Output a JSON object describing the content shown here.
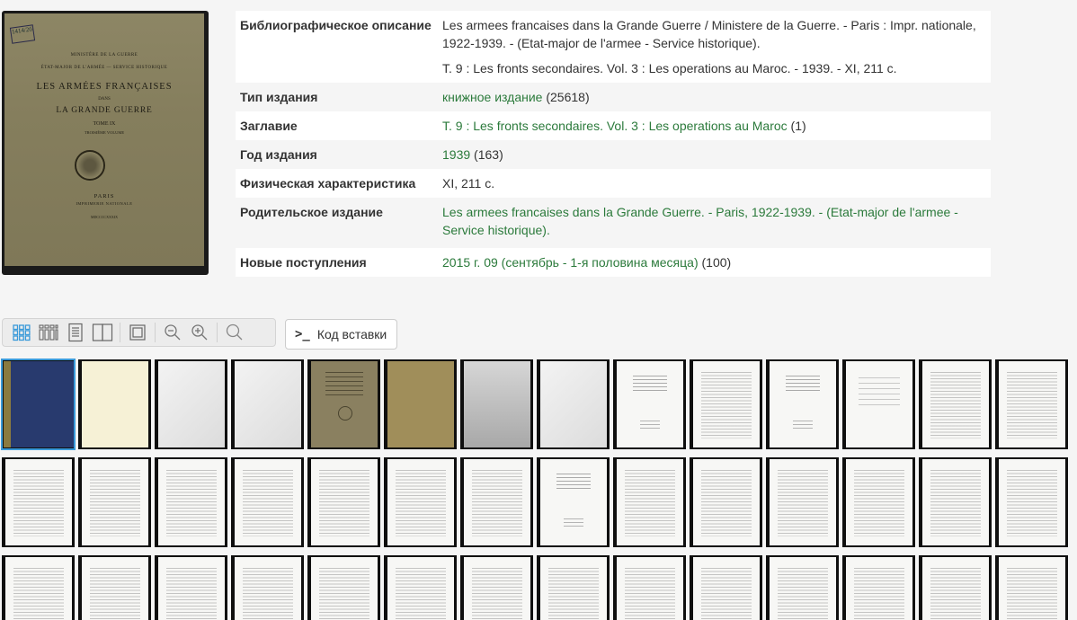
{
  "cover": {
    "stamp": "1414/2б",
    "line1": "MINISTÈRE DE LA GUERRE",
    "line2": "ÉTAT-MAJOR DE L'ARMÉE — SERVICE HISTORIQUE",
    "title1": "LES ARMÉES FRANÇAISES",
    "title2": "DANS",
    "title3": "LA GRANDE GUERRE",
    "tome": "TOME IX",
    "volume": "TROISIÈME VOLUME",
    "place": "PARIS",
    "press": "IMPRIMERIE NATIONALE",
    "year": "MDCCCCXXXIX"
  },
  "biblio": [
    {
      "label": "Библиографическое описание",
      "values": [
        "Les armees francaises dans la Grande Guerre / Ministere de la Guerre. - Paris : Impr. nationale, 1922-1939. - (Etat-major de l'armee - Service historique).",
        "T. 9 : Les fronts secondaires. Vol. 3 : Les operations au Maroc. - 1939. - XI, 211 с."
      ]
    },
    {
      "label": "Тип издания",
      "link": "книжное издание",
      "count": "(25618)"
    },
    {
      "label": "Заглавие",
      "link": "Т. 9 : Les fronts secondaires. Vol. 3 : Les operations au Maroc",
      "count": "(1)"
    },
    {
      "label": "Год издания",
      "link": "1939",
      "count": "(163)"
    },
    {
      "label": "Физическая характеристика",
      "text": "XI, 211 с."
    },
    {
      "label": "Родительское издание",
      "link": "Les armees francaises dans la Grande Guerre. - Paris, 1922-1939. - (Etat-major de l'armee - Service historique)."
    },
    {
      "label": "Новые поступления",
      "link": "2015 г. 09 (сентябрь - 1-я половина месяца)",
      "count": "(100)"
    }
  ],
  "toolbar": {
    "buttons": [
      "grid-large-icon",
      "grid-small-icon",
      "single-page-icon",
      "book-spread-icon",
      "fit-icon",
      "zoom-out-icon",
      "zoom-in-icon",
      "search-icon"
    ],
    "embed_label": "Код вставки",
    "embed_icon": ">_",
    "accent": "#3a9ad9",
    "link_color": "#2b7a3b"
  },
  "thumbnails": [
    "blue",
    "cream",
    "blank",
    "blank",
    "olive",
    "tan",
    "gray",
    "blank",
    "title",
    "text",
    "title",
    "sparse",
    "text",
    "text",
    "text",
    "text",
    "text",
    "text",
    "text",
    "text",
    "text",
    "title",
    "text",
    "text",
    "text",
    "text",
    "text",
    "text",
    "text",
    "text",
    "text",
    "text",
    "text",
    "text",
    "text",
    "text",
    "text",
    "text",
    "text",
    "text",
    "text",
    "text"
  ]
}
